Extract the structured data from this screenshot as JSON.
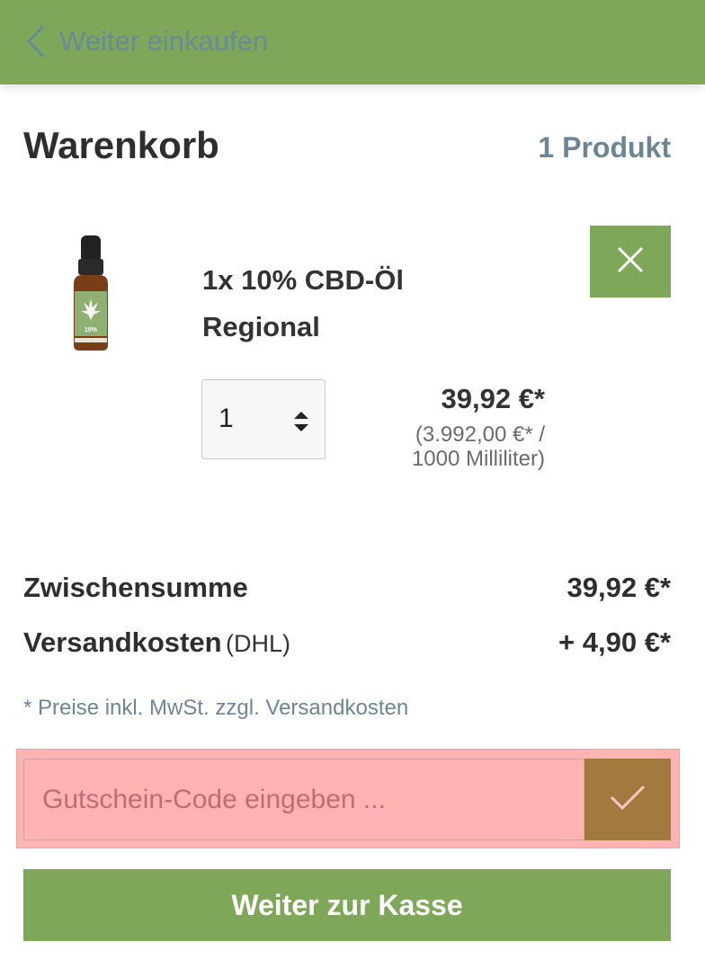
{
  "nav": {
    "back_label": "Weiter einkaufen"
  },
  "cart": {
    "title": "Warenkorb",
    "count": "1 Produkt"
  },
  "item": {
    "name_line1": "1x 10% CBD-Öl",
    "name_line2": "Regional",
    "quantity": "1",
    "price": "39,92 €*",
    "ref_price_line1": "(3.992,00 €* /",
    "ref_price_line2": "1000 Milliliter)",
    "image_label": "10%"
  },
  "summary": {
    "subtotal_label": "Zwischensumme",
    "subtotal_value": "39,92 €*",
    "shipping_label": "Versandkosten",
    "shipping_carrier": "(DHL)",
    "shipping_value": "+ 4,90 €*",
    "tax_note": "* Preise inkl. MwSt. zzgl. Versandkosten"
  },
  "voucher": {
    "placeholder": "Gutschein-Code eingeben ...",
    "value": ""
  },
  "checkout": {
    "label": "Weiter zur Kasse"
  },
  "colors": {
    "primary_green": "#7ea75a",
    "highlight": "#ffb3b3",
    "voucher_button": "#a2793f",
    "muted_text": "#6e8594"
  }
}
